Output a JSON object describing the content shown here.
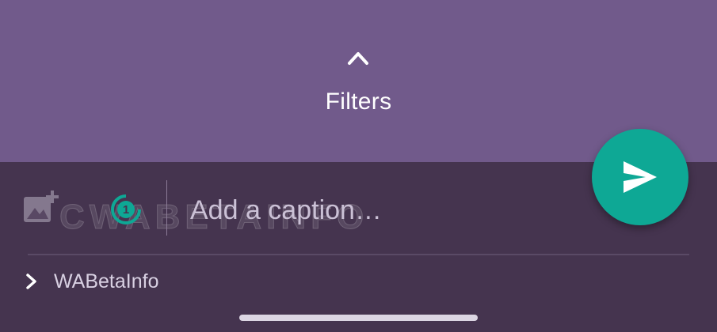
{
  "filters": {
    "label": "Filters",
    "icon": "chevron-up-icon"
  },
  "caption": {
    "placeholder": "Add a caption…",
    "value": ""
  },
  "view_once": {
    "number": "1",
    "icon": "view-once-icon",
    "color": "#0ea895"
  },
  "add_media": {
    "icon": "add-photo-icon"
  },
  "send": {
    "icon": "send-icon",
    "color": "#0ea895"
  },
  "recipient": {
    "label": "WABetaInfo",
    "icon": "chevron-right-icon"
  },
  "watermark": {
    "text": "CWABETAINFO"
  },
  "colors": {
    "top_panel": "#715a8b",
    "bottom_panel": "#45344f",
    "accent": "#0ea895"
  }
}
